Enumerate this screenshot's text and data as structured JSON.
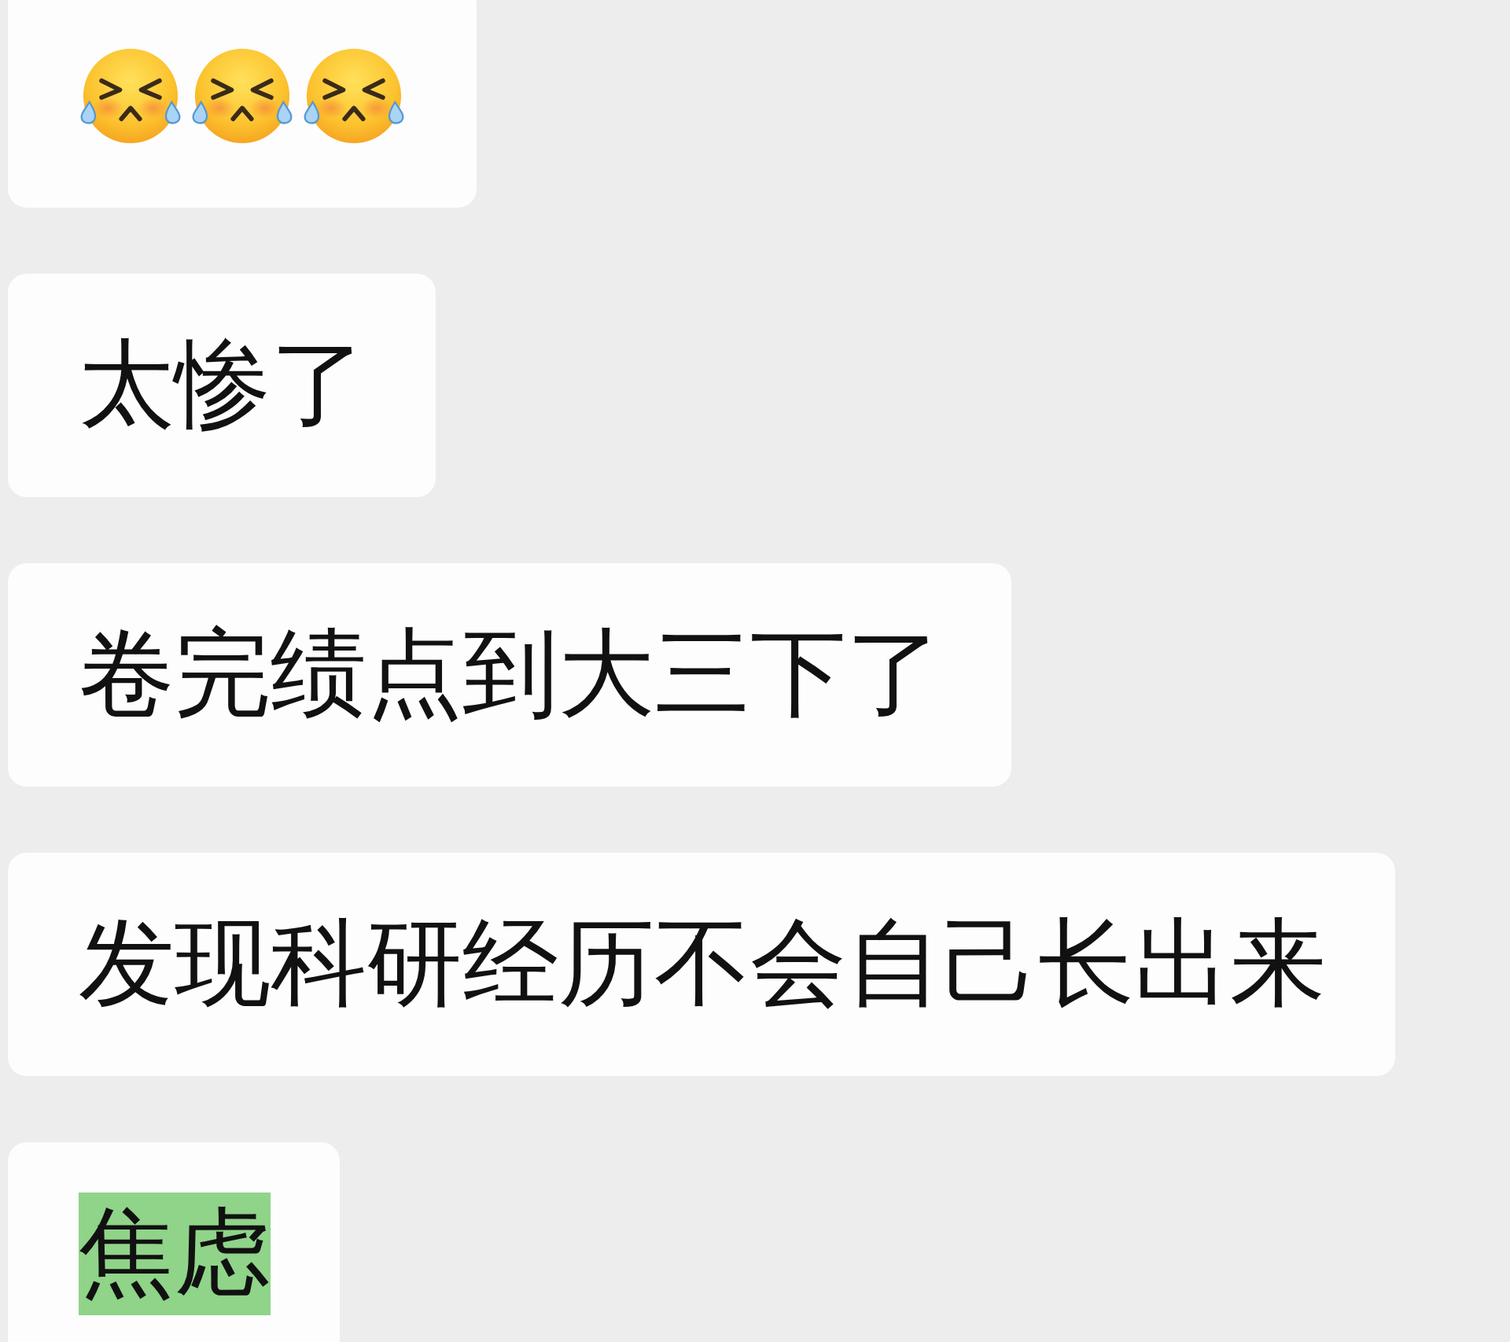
{
  "messages": [
    {
      "kind": "emoji",
      "emoji": [
        {
          "kind": "crying"
        },
        {
          "kind": "crying"
        },
        {
          "kind": "crying"
        }
      ]
    },
    {
      "kind": "text",
      "text": "太惨了",
      "highlighted": false
    },
    {
      "kind": "text",
      "text": "卷完绩点到大三下了",
      "highlighted": false
    },
    {
      "kind": "text",
      "text": "发现科研经历不会自己长出来",
      "highlighted": false
    },
    {
      "kind": "text",
      "text": "焦虑",
      "highlighted": true
    }
  ]
}
